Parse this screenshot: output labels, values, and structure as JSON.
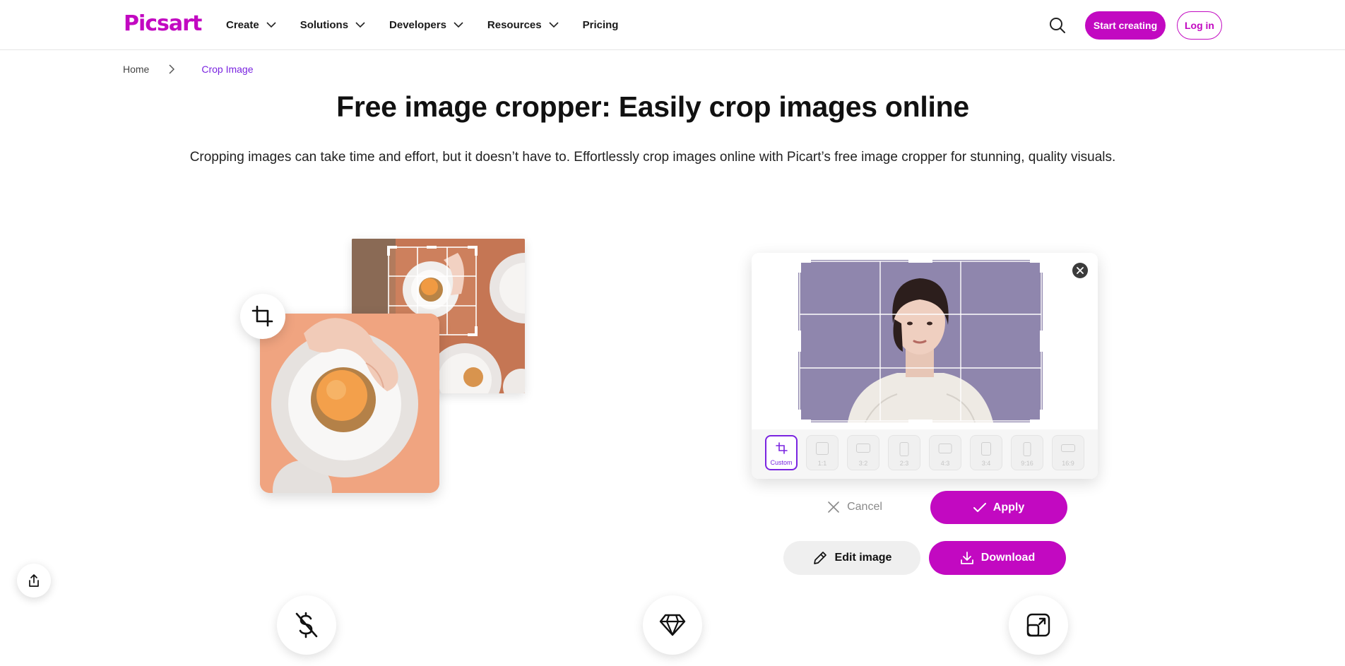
{
  "header": {
    "logo": "Picsart",
    "nav": [
      {
        "label": "Create"
      },
      {
        "label": "Solutions"
      },
      {
        "label": "Developers"
      },
      {
        "label": "Resources"
      },
      {
        "label": "Pricing"
      }
    ],
    "start_label": "Start creating",
    "login_label": "Log in"
  },
  "breadcrumb": {
    "home": "Home",
    "current": "Crop Image"
  },
  "hero": {
    "title": "Free image cropper: Easily crop images online",
    "subtitle": "Cropping images can take time and effort, but it doesn’t have to. Effortlessly crop images online with Picart’s free image cropper for stunning, quality visuals."
  },
  "editor": {
    "ratios": [
      {
        "label": "Custom",
        "active": true
      },
      {
        "label": "1:1"
      },
      {
        "label": "3:2"
      },
      {
        "label": "2:3"
      },
      {
        "label": "4:3"
      },
      {
        "label": "3:4"
      },
      {
        "label": "9:16"
      },
      {
        "label": "16:9"
      }
    ],
    "cancel_label": "Cancel",
    "apply_label": "Apply",
    "edit_label": "Edit image",
    "download_label": "Download"
  },
  "colors": {
    "brand": "#c209c1",
    "accent_purple": "#7a24e0"
  },
  "icons": [
    "search-icon",
    "chevron-down-icon",
    "chevron-right-icon",
    "crop-icon",
    "close-icon",
    "check-icon",
    "pencil-icon",
    "download-icon",
    "share-icon",
    "dollar-off-icon",
    "diamond-icon",
    "resize-icon"
  ]
}
